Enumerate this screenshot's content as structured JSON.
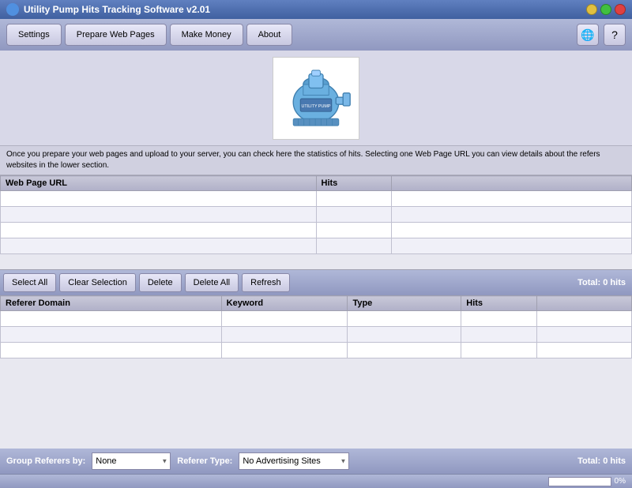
{
  "window": {
    "title": "Utility Pump Hits Tracking Software v2.01"
  },
  "toolbar": {
    "settings_label": "Settings",
    "prepare_label": "Prepare Web Pages",
    "make_money_label": "Make Money",
    "about_label": "About"
  },
  "info_text": "Once you prepare your web pages and upload to your server, you can check here the statistics of hits. Selecting one Web Page URL you can view details about the refers websites in the lower section.",
  "top_table": {
    "columns": [
      "Web Page URL",
      "Hits",
      ""
    ],
    "rows": [
      [
        "",
        "",
        ""
      ],
      [
        "",
        "",
        ""
      ],
      [
        "",
        "",
        ""
      ],
      [
        "",
        "",
        ""
      ]
    ]
  },
  "action_buttons": {
    "select_all": "Select All",
    "clear_selection": "Clear Selection",
    "delete": "Delete",
    "delete_all": "Delete All",
    "refresh": "Refresh",
    "total": "Total: 0 hits"
  },
  "bottom_table": {
    "columns": [
      "Referer Domain",
      "Keyword",
      "Type",
      "Hits",
      ""
    ],
    "rows": [
      [
        "",
        "",
        "",
        "",
        ""
      ],
      [
        "",
        "",
        "",
        "",
        ""
      ],
      [
        "",
        "",
        "",
        "",
        ""
      ]
    ]
  },
  "bottom_bar": {
    "group_label": "Group Referers by:",
    "group_options": [
      "None"
    ],
    "group_selected": "None",
    "referer_label": "Referer Type:",
    "referer_options": [
      "No Advertising Sites"
    ],
    "referer_selected": "No Advertising Sites",
    "total": "Total: 0 hits"
  },
  "status_bar": {
    "progress_percent": "0%",
    "progress_value": 0
  }
}
